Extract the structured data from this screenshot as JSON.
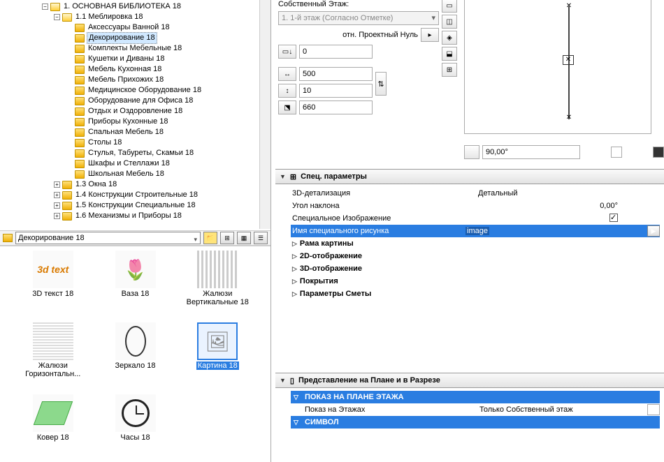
{
  "tree": {
    "root": "1. ОСНОВНАЯ БИБЛИОТЕКА 18",
    "sub1": "1.1 Меблировка 18",
    "items": [
      "Аксессуары Ванной 18",
      "Декорирование 18",
      "Комплекты Мебельные 18",
      "Кушетки и Диваны 18",
      "Мебель Кухонная 18",
      "Мебель Прихожих 18",
      "Медицинское Оборудование 18",
      "Оборудование для Офиса 18",
      "Отдых и Оздоровление 18",
      "Приборы Кухонные 18",
      "Спальная Мебель 18",
      "Столы 18",
      "Стулья, Табуреты, Скамьи 18",
      "Шкафы и Стеллажи 18",
      "Школьная Мебель 18"
    ],
    "more": [
      "1.3 Окна 18",
      "1.4 Конструкции Строительные 18",
      "1.5 Конструкции Специальные 18",
      "1.6 Механизмы и Приборы 18"
    ],
    "selected_index": 1
  },
  "library_bar": {
    "name": "Декорирование 18"
  },
  "thumbs": {
    "items": [
      {
        "cap": "3D текст 18",
        "pic": "3d text"
      },
      {
        "cap": "Ваза 18",
        "pic": "🌷"
      },
      {
        "cap": "Жалюзи Вертикальные 18",
        "pic": "𝄖𝄖𝄖"
      },
      {
        "cap": "Жалюзи Горизонтальн...",
        "pic": "☰"
      },
      {
        "cap": "Зеркало 18",
        "pic": "◯"
      },
      {
        "cap": "Картина 18",
        "pic": "🖼"
      },
      {
        "cap": "Ковер 18",
        "pic": "▱"
      },
      {
        "cap": "Часы 18",
        "pic": "🕑"
      }
    ],
    "selected_index": 5
  },
  "params_top": {
    "own_story_label": "Собственный Этаж:",
    "story_value": "1. 1-й этаж (Согласно Отметке)",
    "rel_zero_label": "отн. Проектный Нуль",
    "z": "0",
    "w": "500",
    "h": "10",
    "d": "660",
    "angle": "90,00°"
  },
  "spec": {
    "header": "Спец. параметры",
    "rows": {
      "detail_lbl": "3D-детализация",
      "detail_val": "Детальный",
      "tilt_lbl": "Угол наклона",
      "tilt_val": "0,00°",
      "specimg_lbl": "Специальное Изображение",
      "imgname_lbl": "Имя специального рисунка",
      "imgname_val": "image"
    },
    "groups": [
      "Рама картины",
      "2D-отображение",
      "3D-отображение",
      "Покрытия",
      "Параметры Сметы"
    ]
  },
  "plan": {
    "header": "Представление на Плане и в Разрезе",
    "blue1": "ПОКАЗ НА ПЛАНЕ ЭТАЖА",
    "row1_lbl": "Показ на Этажах",
    "row1_val": "Только Собственный этаж",
    "blue2": "СИМВОЛ"
  }
}
